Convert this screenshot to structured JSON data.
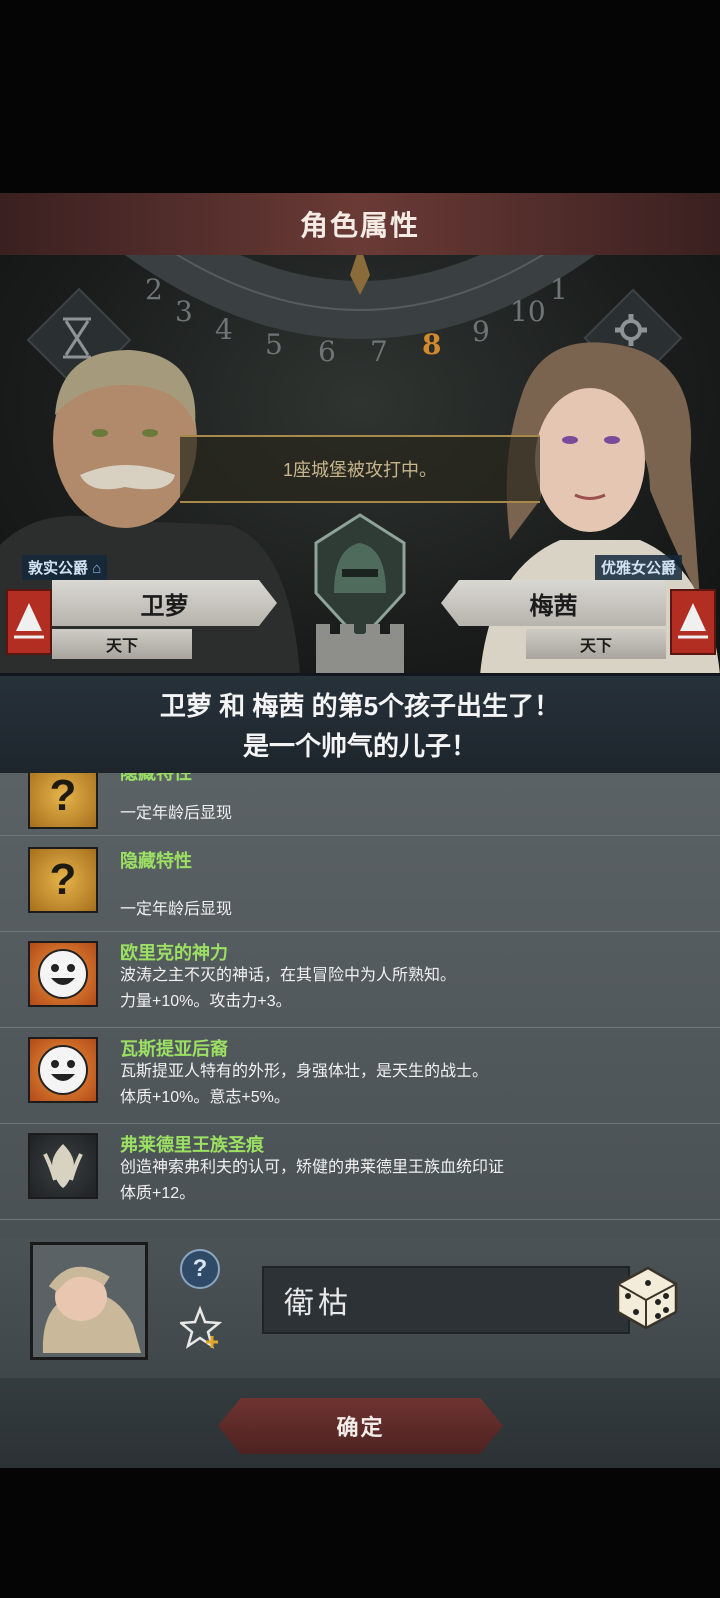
{
  "header": {
    "title": "角色属性"
  },
  "scene": {
    "time_dial_numbers": [
      "2",
      "3",
      "4",
      "5",
      "6",
      "7",
      "8",
      "9",
      "10",
      "1"
    ],
    "current_number": "8",
    "event_text": "1座城堡被攻打中。"
  },
  "father": {
    "title": "敦实公爵",
    "name": "卫萝",
    "realm": "天下"
  },
  "mother": {
    "title": "优雅女公爵",
    "name": "梅茜",
    "realm": "天下"
  },
  "announcement": {
    "line1": "卫萝 和 梅茜 的第5个孩子出生了！",
    "line2": "是一个帅气的儿子！"
  },
  "traits": [
    {
      "name": "隐藏特性",
      "desc": "一定年龄后显现",
      "effect": "",
      "icon": "question-icon"
    },
    {
      "name": "隐藏特性",
      "desc": "一定年龄后显现",
      "effect": "",
      "icon": "question-icon"
    },
    {
      "name": "欧里克的神力",
      "desc": "波涛之主不灭的神话，在其冒险中为人所熟知。",
      "effect": "力量+10%。攻击力+3。",
      "icon": "smile-icon"
    },
    {
      "name": "瓦斯提亚后裔",
      "desc": "瓦斯提亚人特有的外形，身强体壮，是天生的战士。",
      "effect": "体质+10%。意志+5%。",
      "icon": "smile-icon"
    },
    {
      "name": "弗莱德里王族圣痕",
      "desc": "创造神索弗利夫的认可，矫健的弗莱德里王族血统印证",
      "effect": "体质+12。",
      "icon": "royal-mark-icon"
    }
  ],
  "child": {
    "name": "衛枯"
  },
  "footer": {
    "confirm_label": "确定"
  },
  "colors": {
    "trait_name": "#9be063",
    "accent_red": "#b22d22",
    "announce_bg": "#1d252c"
  }
}
